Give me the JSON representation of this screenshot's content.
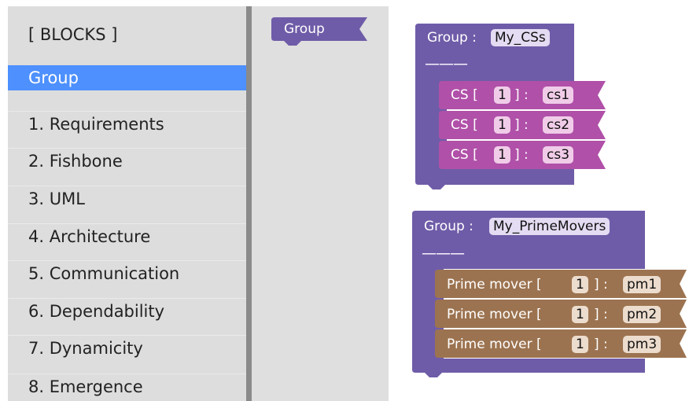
{
  "toolbox": {
    "title": "[ BLOCKS ]",
    "categories": [
      {
        "label": "Group",
        "selected": true
      },
      {
        "label": "1. Requirements"
      },
      {
        "label": "2. Fishbone"
      },
      {
        "label": "3. UML"
      },
      {
        "label": "4. Architecture"
      },
      {
        "label": "5. Communication"
      },
      {
        "label": "6. Dependability"
      },
      {
        "label": "7. Dynamicity"
      },
      {
        "label": "8. Emergence"
      }
    ]
  },
  "flyout": {
    "block_label": "Group"
  },
  "workspace": {
    "group1": {
      "label": "Group :",
      "name": "My_CSs",
      "separator": "———",
      "items": [
        {
          "prefix": "CS  [",
          "count": "1",
          "suffix": "] :",
          "name": "cs1"
        },
        {
          "prefix": "CS  [",
          "count": "1",
          "suffix": "] :",
          "name": "cs2"
        },
        {
          "prefix": "CS  [",
          "count": "1",
          "suffix": "] :",
          "name": "cs3"
        }
      ]
    },
    "group2": {
      "label": "Group :",
      "name": "My_PrimeMovers",
      "separator": "———",
      "items": [
        {
          "prefix": "Prime mover  [",
          "count": "1",
          "suffix": "] :",
          "name": "pm1"
        },
        {
          "prefix": "Prime mover  [",
          "count": "1",
          "suffix": "] :",
          "name": "pm2"
        },
        {
          "prefix": "Prime mover  [",
          "count": "1",
          "suffix": "] :",
          "name": "pm3"
        }
      ]
    }
  },
  "colors": {
    "selected": "#4d90fe",
    "group_block": "#6f5ca8",
    "cs_block": "#b050a8",
    "prime_mover_block": "#9c7350"
  }
}
